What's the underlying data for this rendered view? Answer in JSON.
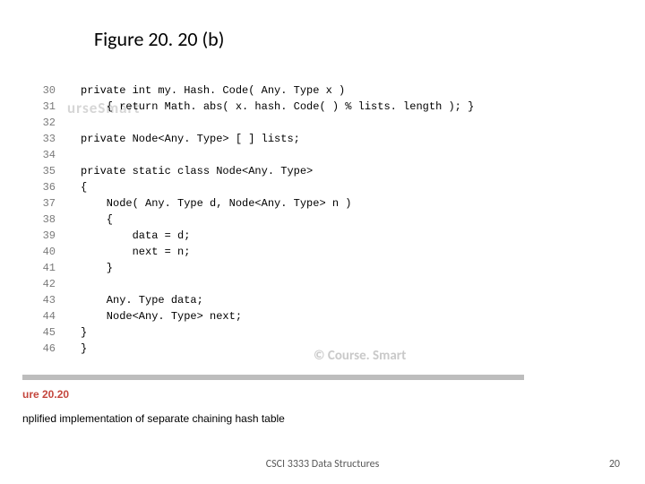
{
  "title": "Figure 20. 20 (b)",
  "watermark_left": "urseSmart",
  "watermark_right": "© Course. Smart",
  "code_lines": [
    {
      "n": "30",
      "t": "private int my. Hash. Code( Any. Type x )"
    },
    {
      "n": "31",
      "t": "    { return Math. abs( x. hash. Code( ) % lists. length ); }"
    },
    {
      "n": "32",
      "t": ""
    },
    {
      "n": "33",
      "t": "private Node<Any. Type> [ ] lists;"
    },
    {
      "n": "34",
      "t": ""
    },
    {
      "n": "35",
      "t": "private static class Node<Any. Type>"
    },
    {
      "n": "36",
      "t": "{"
    },
    {
      "n": "37",
      "t": "    Node( Any. Type d, Node<Any. Type> n )"
    },
    {
      "n": "38",
      "t": "    {"
    },
    {
      "n": "39",
      "t": "        data = d;"
    },
    {
      "n": "40",
      "t": "        next = n;"
    },
    {
      "n": "41",
      "t": "    }"
    },
    {
      "n": "42",
      "t": ""
    },
    {
      "n": "43",
      "t": "    Any. Type data;"
    },
    {
      "n": "44",
      "t": "    Node<Any. Type> next;"
    },
    {
      "n": "45",
      "t": "}"
    },
    {
      "n": "46",
      "t": "}"
    }
  ],
  "figure_label": "ure 20.20",
  "caption": "nplified implementation of separate chaining hash table",
  "footer_center": "CSCI 3333 Data Structures",
  "page_number": "20"
}
